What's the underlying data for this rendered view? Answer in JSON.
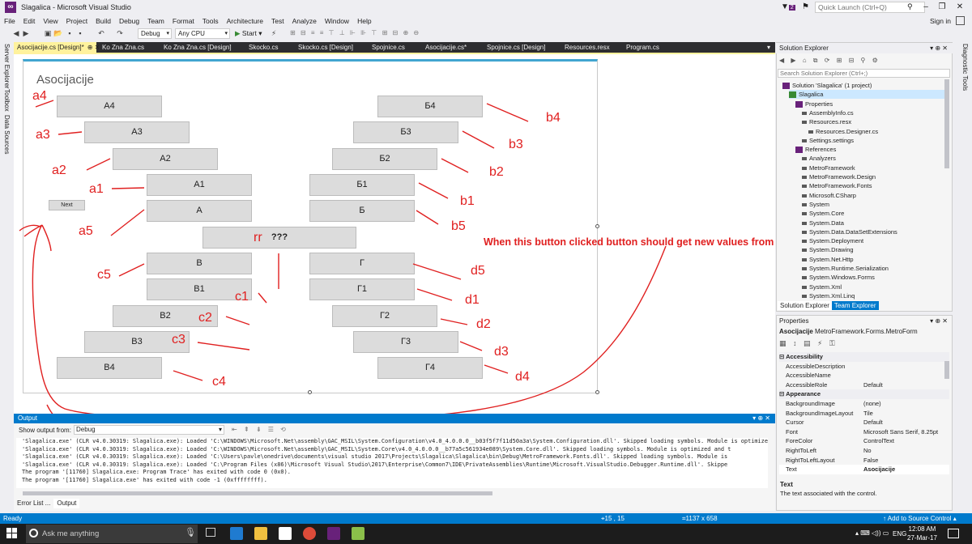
{
  "window": {
    "title": "Slagalica - Microsoft Visual Studio",
    "quick_launch_placeholder": "Quick Launch (Ctrl+Q)",
    "notification_count": "2",
    "sign_in": "Sign in"
  },
  "menu": [
    "File",
    "Edit",
    "View",
    "Project",
    "Build",
    "Debug",
    "Team",
    "Format",
    "Tools",
    "Architecture",
    "Test",
    "Analyze",
    "Window",
    "Help"
  ],
  "toolbar": {
    "config": "Debug",
    "platform": "Any CPU",
    "start": "Start"
  },
  "left_rail": [
    "Server Explorer",
    "Toolbox",
    "Data Sources"
  ],
  "right_rail": [
    "Diagnostic Tools"
  ],
  "doc_tabs": [
    {
      "label": "Asocijacije.cs [Design]*",
      "active": true
    },
    {
      "label": "Ko Zna Zna.cs"
    },
    {
      "label": "Ko Zna Zna.cs [Design]"
    },
    {
      "label": "Skocko.cs"
    },
    {
      "label": "Skocko.cs [Design]"
    },
    {
      "label": "Spojnice.cs"
    },
    {
      "label": "Asocijacije.cs*"
    },
    {
      "label": "Spojnice.cs [Design]"
    },
    {
      "label": "Resources.resx"
    },
    {
      "label": "Program.cs"
    }
  ],
  "designer": {
    "form_title": "Asocijacije",
    "next_button": "Next",
    "buttons": {
      "a4": "А4",
      "a3": "А3",
      "a2": "А2",
      "a1": "А1",
      "a": "А",
      "b4": "Б4",
      "b3": "Б3",
      "b2": "Б2",
      "b1": "Б1",
      "b": "Б",
      "center": "???",
      "c": "В",
      "c1": "В1",
      "c2": "В2",
      "c3": "В3",
      "c4": "В4",
      "d": "Г",
      "d1": "Г1",
      "d2": "Г2",
      "d3": "Г3",
      "d4": "Г4"
    },
    "annotations": {
      "a4": "a4",
      "a3": "a3",
      "a2": "a2",
      "a1": "a1",
      "a5": "a5",
      "b4": "b4",
      "b3": "b3",
      "b2": "b2",
      "b1": "b1",
      "b5": "b5",
      "c5": "c5",
      "c1": "c1",
      "c2": "c2",
      "c3": "c3",
      "c4": "c4",
      "d5": "d5",
      "d1": "d1",
      "d2": "d2",
      "d3": "d3",
      "d4": "d4",
      "rr": "rr",
      "note": "When this button clicked button should get new values from new random json object"
    }
  },
  "output": {
    "title": "Output",
    "show_from_label": "Show output from:",
    "show_from_value": "Debug",
    "lines": [
      "'Slagalica.exe' (CLR v4.0.30319: Slagalica.exe): Loaded 'C:\\WINDOWS\\Microsoft.Net\\assembly\\GAC_MSIL\\System.Configuration\\v4.0_4.0.0.0__b03f5f7f11d50a3a\\System.Configuration.dll'. Skipped loading symbols. Module is optimized and t",
      "'Slagalica.exe' (CLR v4.0.30319: Slagalica.exe): Loaded 'C:\\WINDOWS\\Microsoft.Net\\assembly\\GAC_MSIL\\System.Core\\v4.0_4.0.0.0__b77a5c561934e089\\System.Core.dll'. Skipped loading symbols. Module is optimized and t",
      "'Slagalica.exe' (CLR v4.0.30319: Slagalica.exe): Loaded 'C:\\Users\\pavle\\onedrive\\documents\\visual studio 2017\\Projects\\Slagalica\\Slagalica\\bin\\Debug\\MetroFramework.Fonts.dll'. Skipped loading symbols. Module is",
      "'Slagalica.exe' (CLR v4.0.30319: Slagalica.exe): Loaded 'C:\\Program Files (x86)\\Microsoft Visual Studio\\2017\\Enterprise\\Common7\\IDE\\PrivateAssemblies\\Runtime\\Microsoft.VisualStudio.Debugger.Runtime.dll'. Skippe",
      "The program '[11760] Slagalica.exe: Program Trace' has exited with code 0 (0x0).",
      "The program '[11760] Slagalica.exe' has exited with code -1 (0xffffffff)."
    ],
    "tabs": [
      "Error List ...",
      "Output"
    ]
  },
  "solution_explorer": {
    "title": "Solution Explorer",
    "search_placeholder": "Search Solution Explorer (Ctrl+;)",
    "items": [
      {
        "label": "Solution 'Slagalica' (1 project)",
        "indent": 0
      },
      {
        "label": "Slagalica",
        "indent": 1,
        "selected": true
      },
      {
        "label": "Properties",
        "indent": 2
      },
      {
        "label": "AssemblyInfo.cs",
        "indent": 3
      },
      {
        "label": "Resources.resx",
        "indent": 3
      },
      {
        "label": "Resources.Designer.cs",
        "indent": 4
      },
      {
        "label": "Settings.settings",
        "indent": 3
      },
      {
        "label": "References",
        "indent": 2
      },
      {
        "label": "Analyzers",
        "indent": 3
      },
      {
        "label": "MetroFramework",
        "indent": 3
      },
      {
        "label": "MetroFramework.Design",
        "indent": 3
      },
      {
        "label": "MetroFramework.Fonts",
        "indent": 3
      },
      {
        "label": "Microsoft.CSharp",
        "indent": 3
      },
      {
        "label": "System",
        "indent": 3
      },
      {
        "label": "System.Core",
        "indent": 3
      },
      {
        "label": "System.Data",
        "indent": 3
      },
      {
        "label": "System.Data.DataSetExtensions",
        "indent": 3
      },
      {
        "label": "System.Deployment",
        "indent": 3
      },
      {
        "label": "System.Drawing",
        "indent": 3
      },
      {
        "label": "System.Net.Http",
        "indent": 3
      },
      {
        "label": "System.Runtime.Serialization",
        "indent": 3
      },
      {
        "label": "System.Windows.Forms",
        "indent": 3
      },
      {
        "label": "System.Xml",
        "indent": 3
      },
      {
        "label": "System.Xml.Linq",
        "indent": 3
      }
    ],
    "tabs": [
      "Solution Explorer",
      "Team Explorer"
    ]
  },
  "properties": {
    "title": "Properties",
    "object_name": "Asocijacije",
    "object_type": "MetroFramework.Forms.MetroForm",
    "rows": [
      {
        "name": "Accessibility",
        "category": true
      },
      {
        "name": "AccessibleDescription",
        "value": ""
      },
      {
        "name": "AccessibleName",
        "value": ""
      },
      {
        "name": "AccessibleRole",
        "value": "Default"
      },
      {
        "name": "Appearance",
        "category": true
      },
      {
        "name": "BackgroundImage",
        "value": "(none)"
      },
      {
        "name": "BackgroundImageLayout",
        "value": "Tile"
      },
      {
        "name": "Cursor",
        "value": "Default"
      },
      {
        "name": "Font",
        "value": "Microsoft Sans Serif, 8.25pt"
      },
      {
        "name": "ForeColor",
        "value": "ControlText"
      },
      {
        "name": "RightToLeft",
        "value": "No"
      },
      {
        "name": "RightToLeftLayout",
        "value": "False"
      },
      {
        "name": "Text",
        "value": "Asocijacije",
        "selected": true
      }
    ],
    "desc_title": "Text",
    "desc": "The text associated with the control."
  },
  "status": {
    "ready": "Ready",
    "pos": "15 , 15",
    "size": "1137 x 658",
    "add_source": "Add to Source Control"
  },
  "taskbar": {
    "search": "Ask me anything",
    "lang": "ENG",
    "time": "12:08 AM",
    "date": "27-Mar-17",
    "notif": "2"
  },
  "colors": {
    "accent": "#007acc",
    "vs_purple": "#68217a",
    "active_tab": "#fff29d",
    "annotation_red": "#e02020"
  }
}
